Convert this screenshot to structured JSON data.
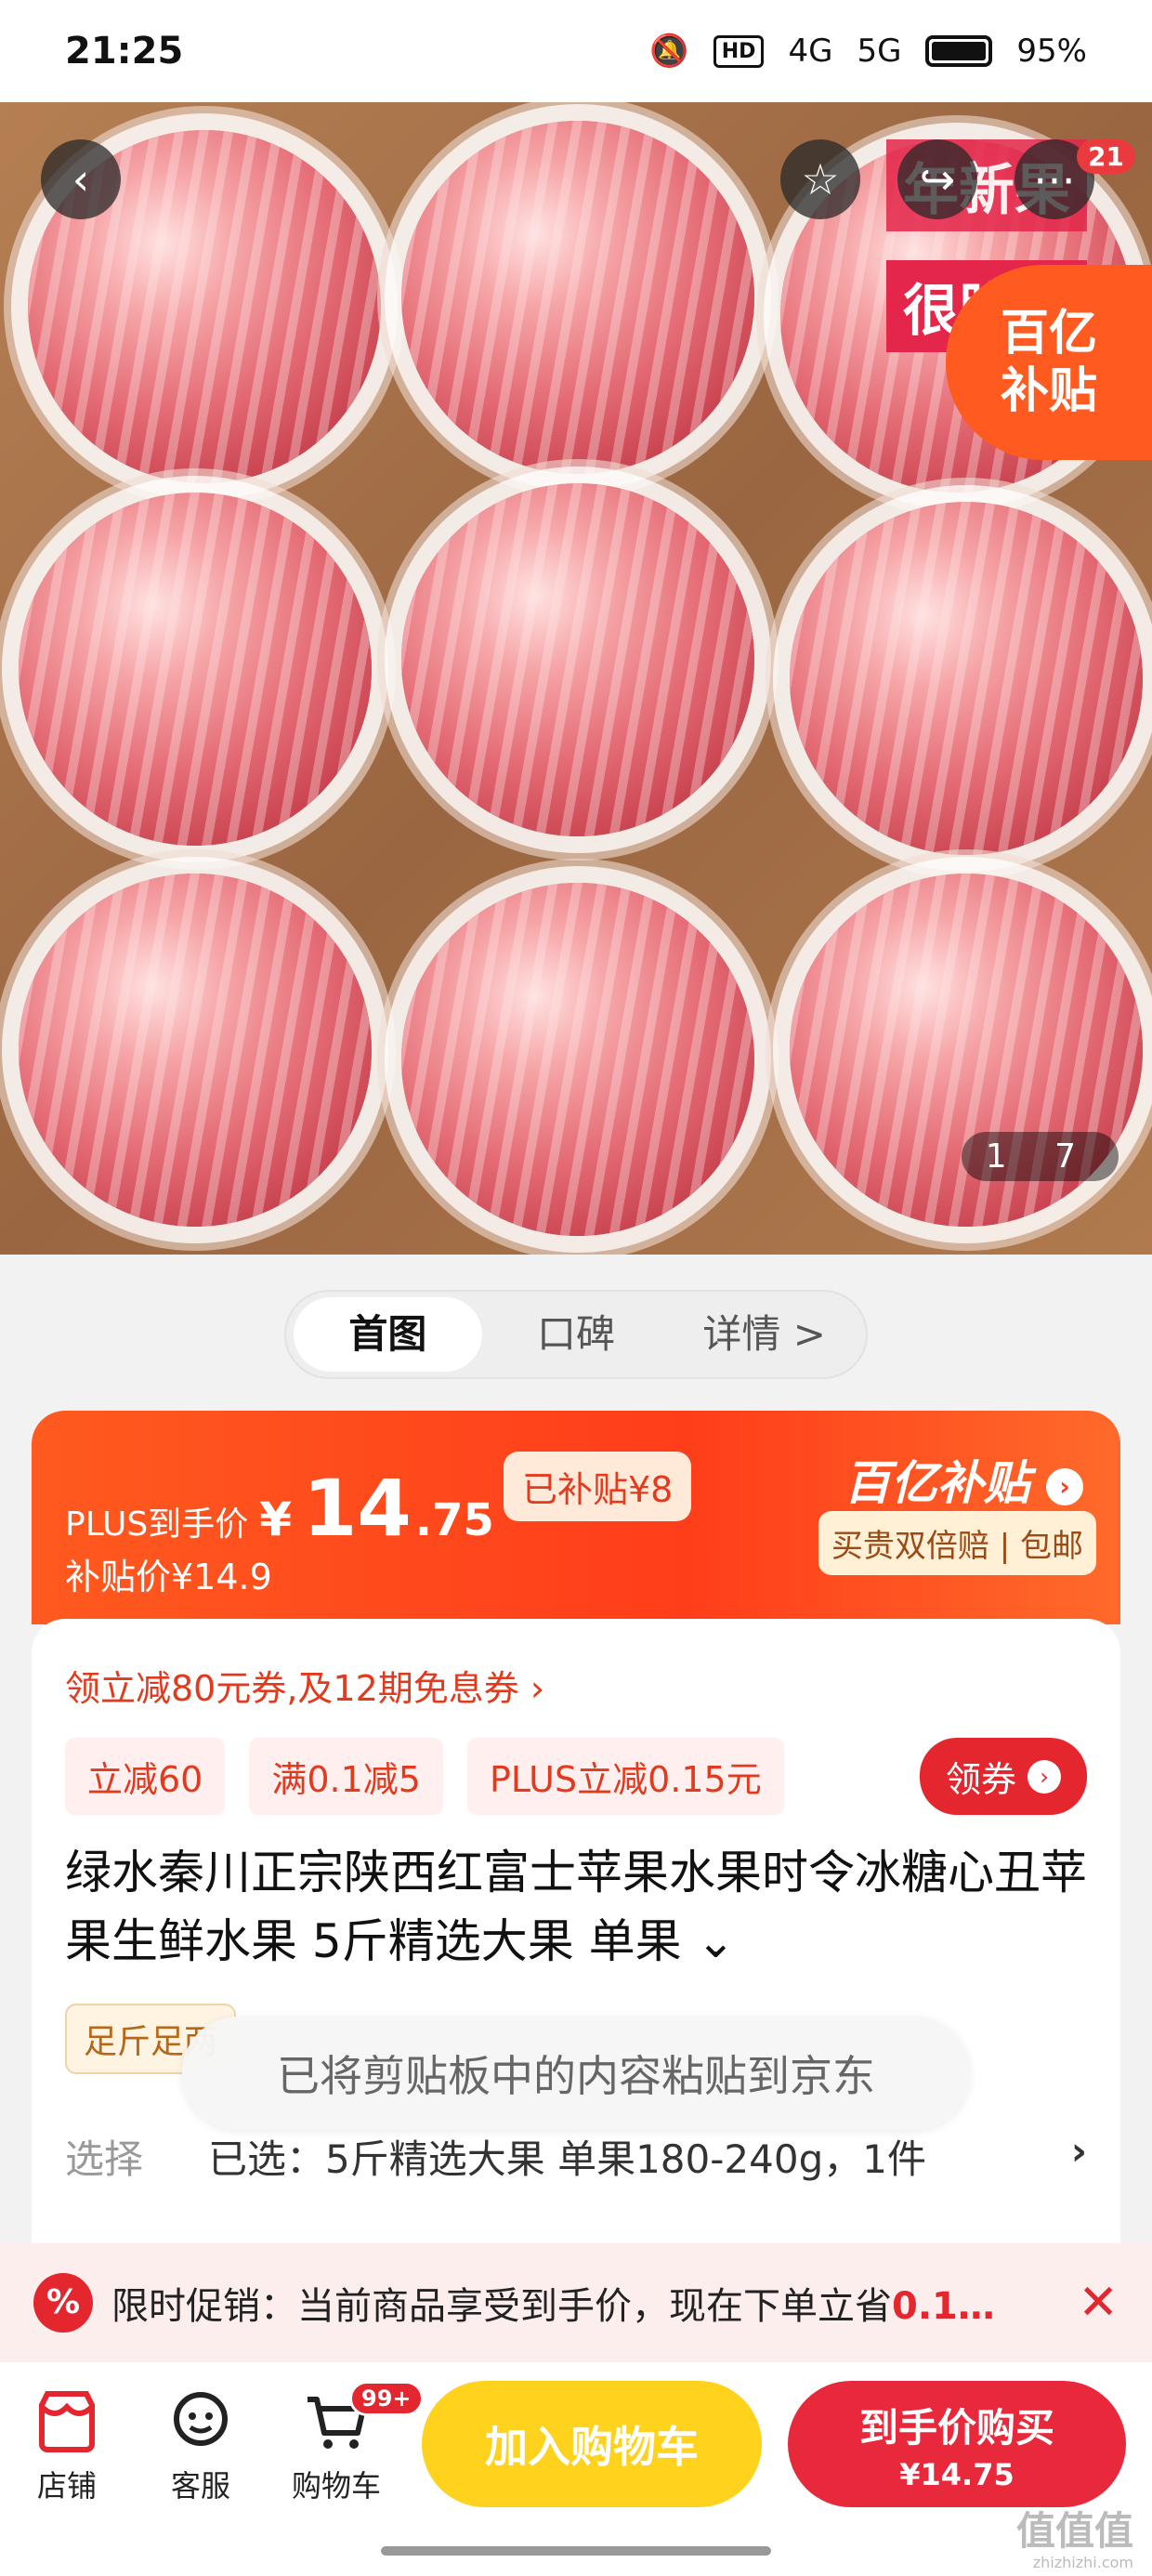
{
  "status_bar": {
    "time": "21:25",
    "network1": "4G",
    "network2": "5G",
    "hd_tag": "HD",
    "battery": "95%"
  },
  "hero": {
    "banner_line1": "年新果",
    "banner_line2": "很脆狠",
    "subsidy_line1": "百亿",
    "subsidy_line2": "补贴",
    "notification_count": "21",
    "counter": "1 7"
  },
  "tabs": [
    {
      "label": "首图",
      "active": true
    },
    {
      "label": "口碑",
      "active": false
    },
    {
      "label": "详情 >",
      "active": false
    }
  ],
  "price": {
    "plus_label": "PLUS到手价",
    "currency": "¥",
    "integer": "14",
    "decimal": ".75",
    "subsidized": "已补贴¥8",
    "subsidy_price": "补贴价¥14.9",
    "brand": "百亿补贴",
    "guarantee": "买贵双倍赔 | 包邮"
  },
  "info": {
    "coupon_line": "领立减80元券,及12期免息券 ›",
    "tags": [
      "立减60",
      "满0.1减5",
      "PLUS立减0.15元"
    ],
    "get_coupon": "领券",
    "title": "绿水秦川正宗陕西红富士苹果水果时令冰糖心丑苹果生鲜水果 5斤精选大果 单果 ⌄",
    "weight_chip": "足斤足两",
    "select_label": "选择",
    "select_value": "已选：5斤精选大果 单果180-240g，1件",
    "select_arrow": "›"
  },
  "toast": "已将剪贴板中的内容粘贴到京东",
  "promo": {
    "icon": "%",
    "text": "限时促销：当前商品享受到手价，现在下单立省",
    "highlight": "0.1…",
    "close": "✕"
  },
  "bottom_nav": {
    "store": "店铺",
    "service": "客服",
    "cart": "购物车",
    "cart_badge": "99+",
    "add_to_cart": "加入购物车",
    "buy_line1": "到手价购买",
    "buy_line2": "¥14.75"
  },
  "watermark": "值值值",
  "watermark_sub": "zhizhizhi.com"
}
